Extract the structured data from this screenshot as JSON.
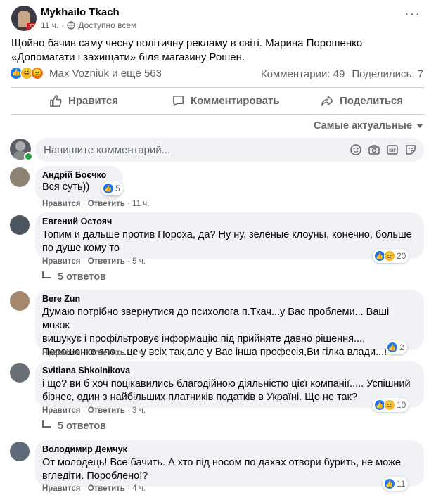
{
  "post": {
    "author": "Mykhailo Tkach",
    "time": "11 ч.",
    "audience": "Доступно всем",
    "text": "Щойно бачив саму чесну політичну рекламу в світі. Марина Порошенко «Допомагати і захищати» біля магазину Рошен.",
    "reactions_text": "Max Vozniuk и ещё 563",
    "comments_count": "Комментарии: 49",
    "shares_count": "Поделились: 7"
  },
  "actions": {
    "like": "Нравится",
    "comment": "Комментировать",
    "share": "Поделиться"
  },
  "sort": {
    "label": "Самые актуальные"
  },
  "composer": {
    "placeholder": "Напишите комментарий..."
  },
  "comment_actions": {
    "like": "Нравится",
    "reply": "Ответить",
    "sep": "·"
  },
  "comments": [
    {
      "name": "Андрій Боєчко",
      "text1": "Вся суть))",
      "text2": "",
      "text3": "",
      "time": "11 ч.",
      "reactions": "5"
    },
    {
      "name": "Евгений Остояч",
      "text1": "Топим и дальше против Пороха, да? Ну ну, зелёные клоуны, конечно, больше",
      "text2": "по душе кому то",
      "text3": "",
      "time": "5 ч.",
      "reactions": "20",
      "replies": "5 ответов"
    },
    {
      "name": "Bere Zun",
      "text1": "Думаю потрібно звернутися до психолога п.Ткач...у Вас проблеми... Ваші мозок",
      "text2": "вишукує і профільтровує інформацію під прийняте давно рішення...,",
      "text3": "Порошенко зло,,..це у всіх так,але у Вас інша професія,Ви гілка влади...!",
      "time": "1 ч.",
      "reactions": "2"
    },
    {
      "name": "Svitlana Shkolnikova",
      "text1": "і що? ви б хоч поцікавились благодійною діяльністю цієї компанії..... Успішний",
      "text2": "бізнес, один з найбільших платників податків в Україні. Що не так?",
      "text3": "",
      "time": "3 ч.",
      "reactions": "10",
      "replies": "5 ответов"
    },
    {
      "name": "Володимир Демчук",
      "text1": "От молодець! Все бачить. А хто під носом по дахах отвори бурить, не може",
      "text2": "вгледіти. Поробленo!?",
      "text3": "",
      "time": "4 ч.",
      "reactions": "11"
    }
  ],
  "colors": {
    "like_blue": "#1877f2",
    "haha_yellow": "#f7b928",
    "angry_orange": "#e9710f",
    "bubble": "#f0f2f5",
    "muted": "#65676b"
  }
}
